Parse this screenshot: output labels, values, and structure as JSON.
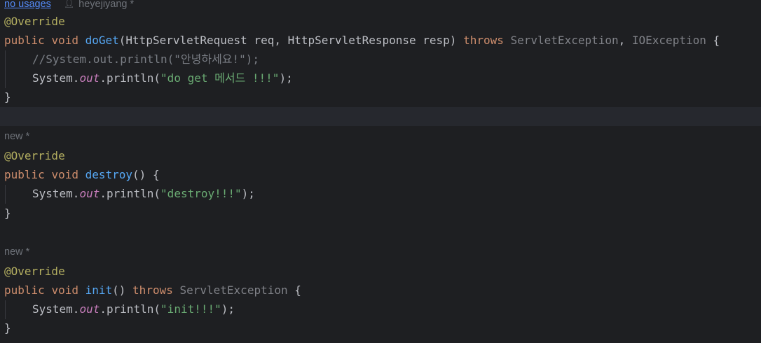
{
  "editor": {
    "hint_usages": "no usages",
    "hint_author": "heyejiyang *",
    "hint_new": "new *",
    "annotation": "@Override",
    "kw_public": "public",
    "kw_void": "void",
    "kw_throws": "throws",
    "method_doget": "doGet",
    "doget_params": "(HttpServletRequest req, HttpServletResponse resp) ",
    "exc_servlet": "ServletException",
    "comma_sp": ", ",
    "exc_io": "IOException",
    "open_brace": " {",
    "close_brace": "}",
    "comment_line": "//System.out.println(\"안녕하세요!\");",
    "system_dot": "System.",
    "out": "out",
    "println_open": ".println(",
    "close_paren_semi": ");",
    "str_doget": "\"do get 메서드 !!!\"",
    "method_destroy": "destroy",
    "empty_parens_brace": "() {",
    "str_destroy": "\"destroy!!!\"",
    "method_init": "init",
    "empty_parens": "() ",
    "str_init": "\"init!!!\"",
    "sp": " "
  }
}
